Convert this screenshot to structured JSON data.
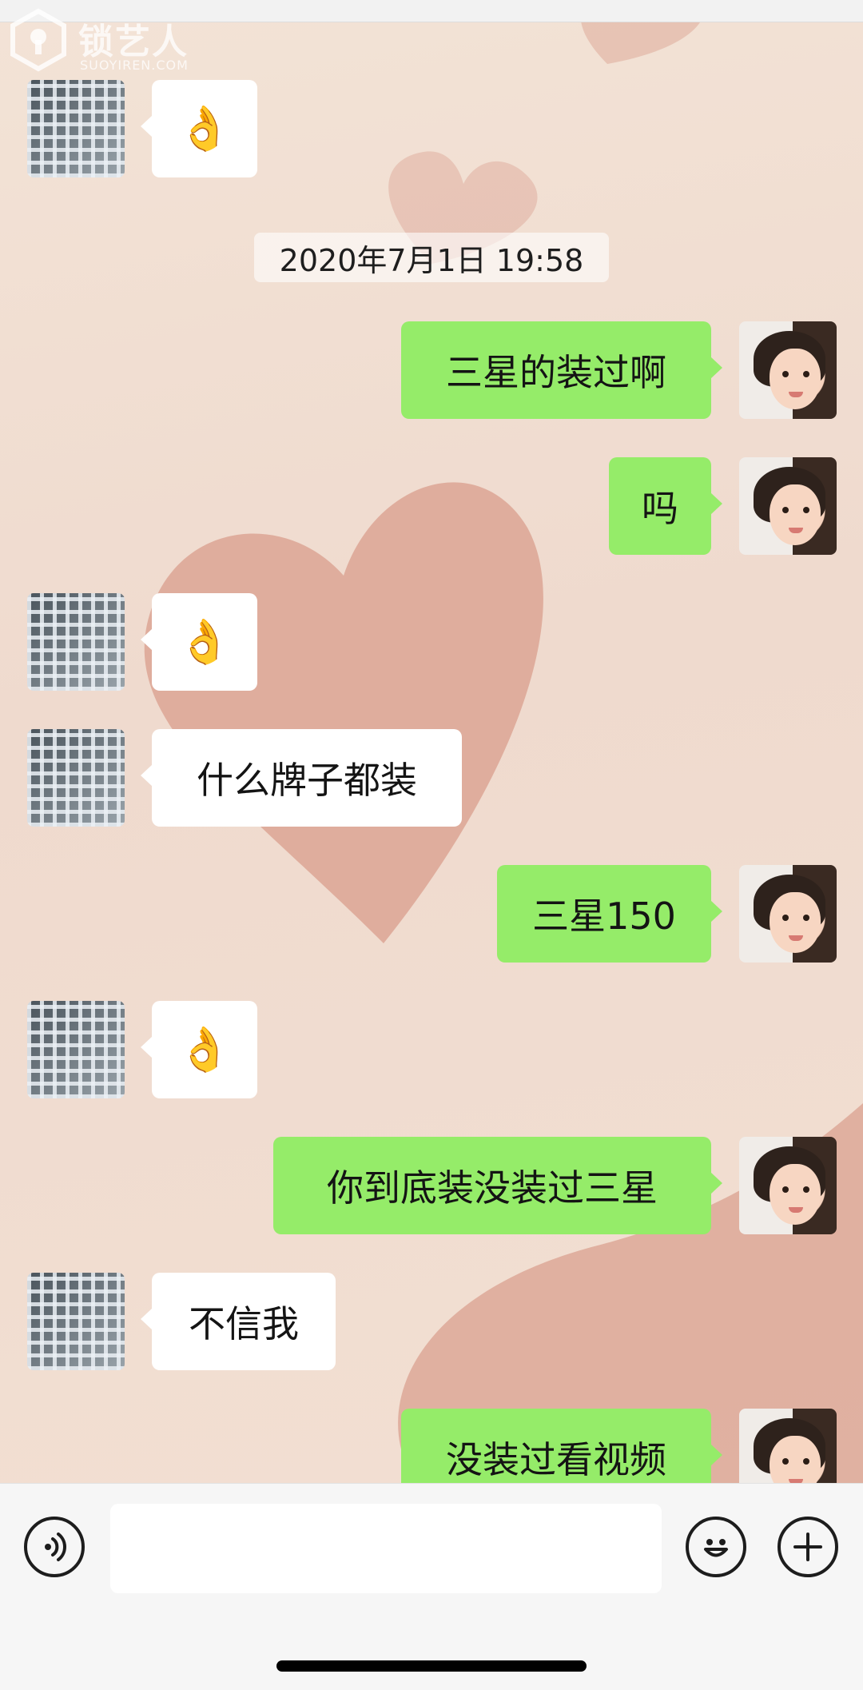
{
  "watermark": {
    "title": "锁艺人",
    "subtitle": "SUOYIREN.COM"
  },
  "timestamp": "2020年7月1日 19:58",
  "messages": [
    {
      "side": "incoming",
      "type": "emoji",
      "icon": "ok-hand-emoji",
      "text": "👌"
    },
    {
      "side": "outgoing",
      "type": "text",
      "text": "三星的装过啊"
    },
    {
      "side": "outgoing",
      "type": "text",
      "text": "吗"
    },
    {
      "side": "incoming",
      "type": "emoji",
      "icon": "ok-hand-emoji",
      "text": "👌"
    },
    {
      "side": "incoming",
      "type": "text",
      "text": "什么牌子都装"
    },
    {
      "side": "outgoing",
      "type": "text",
      "text": "三星150"
    },
    {
      "side": "incoming",
      "type": "emoji",
      "icon": "ok-hand-emoji",
      "text": "👌"
    },
    {
      "side": "outgoing",
      "type": "text",
      "text": "你到底装没装过三星"
    },
    {
      "side": "incoming",
      "type": "text",
      "text": "不信我"
    },
    {
      "side": "outgoing",
      "type": "text",
      "text": "没装过看视频"
    }
  ],
  "input_bar": {
    "voice_icon": "voice-input-icon",
    "text_value": "",
    "emoji_icon": "emoji-face-icon",
    "plus_icon": "plus-icon"
  },
  "colors": {
    "outgoing_bubble": "#95ec69",
    "incoming_bubble": "#ffffff",
    "chat_background": "#f0ddd0",
    "heart": "#d79c8c"
  }
}
